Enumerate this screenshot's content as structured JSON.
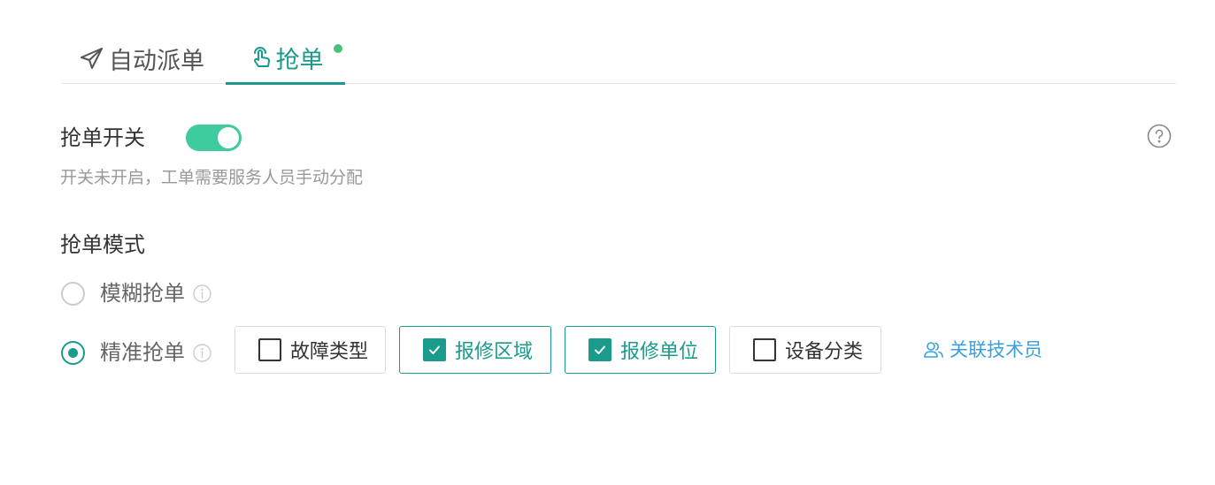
{
  "tabs": [
    {
      "label": "自动派单",
      "icon": "send-icon",
      "active": false
    },
    {
      "label": "抢单",
      "icon": "hand-tap-icon",
      "active": true,
      "has_dot": true
    }
  ],
  "switch_section": {
    "label": "抢单开关",
    "enabled": true,
    "description": "开关未开启，工单需要服务人员手动分配"
  },
  "mode_section": {
    "title": "抢单模式",
    "options": [
      {
        "label": "模糊抢单",
        "selected": false
      },
      {
        "label": "精准抢单",
        "selected": true
      }
    ],
    "criteria": [
      {
        "label": "故障类型",
        "checked": false
      },
      {
        "label": "报修区域",
        "checked": true
      },
      {
        "label": "报修单位",
        "checked": true
      },
      {
        "label": "设备分类",
        "checked": false
      }
    ],
    "link_label": "关联技术员"
  },
  "colors": {
    "accent": "#1a9b8b",
    "toggle_on": "#3ecba0",
    "dot": "#4cbf7a",
    "link": "#3aa0e0"
  }
}
